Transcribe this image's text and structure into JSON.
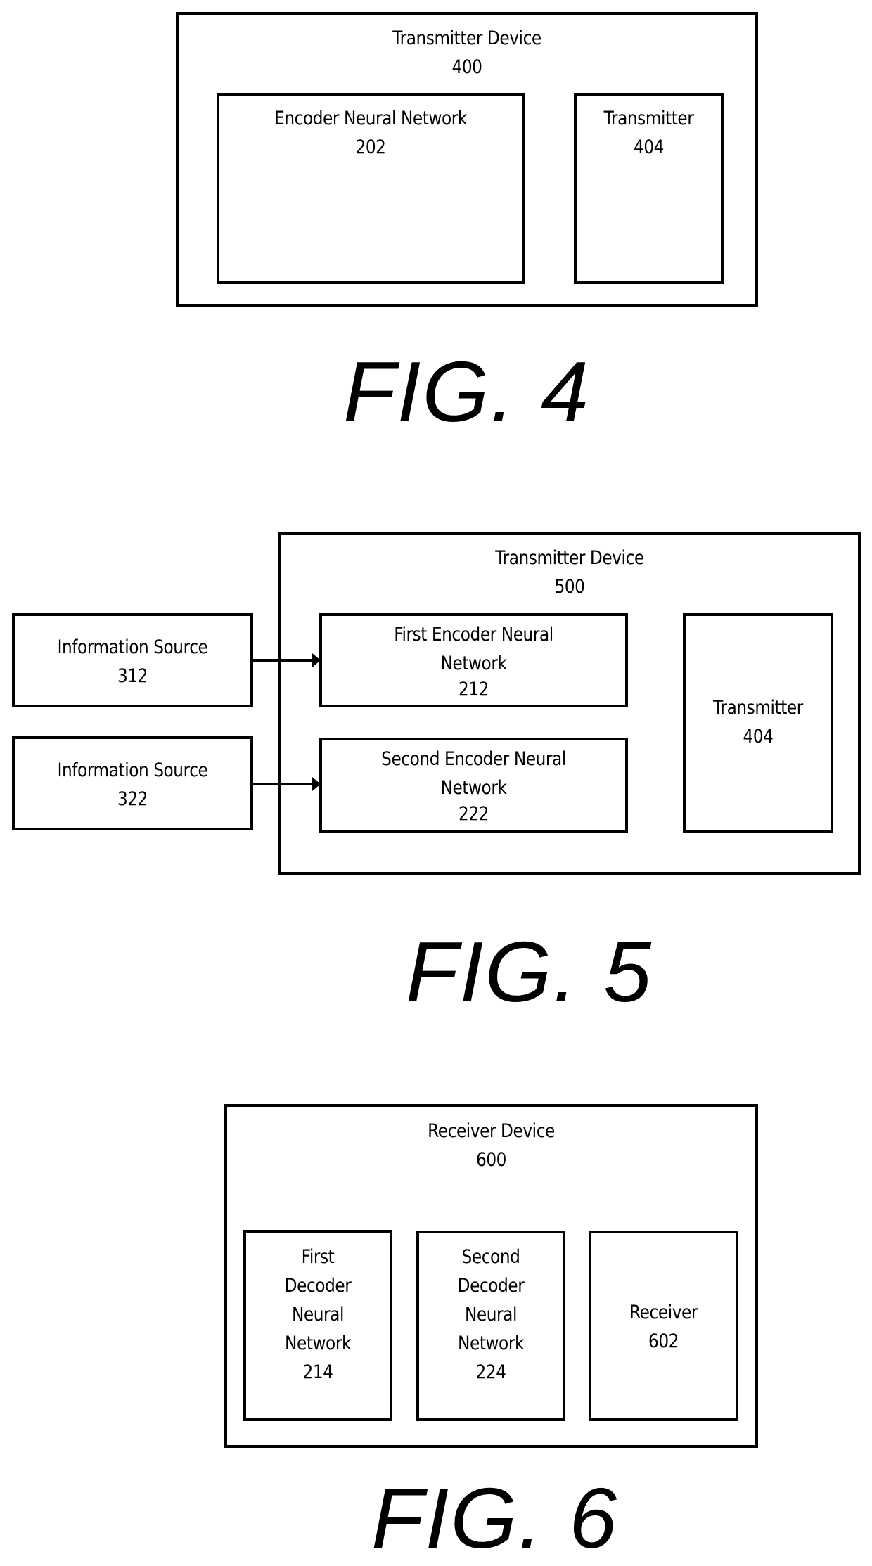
{
  "figures": [
    {
      "caption": "FIG. 4",
      "container": {
        "title": "Transmitter Device",
        "ref": "400"
      },
      "blocks": [
        {
          "title": "Encoder Neural Network",
          "ref": "202"
        },
        {
          "title": "Transmitter",
          "ref": "404"
        }
      ]
    },
    {
      "caption": "FIG. 5",
      "container": {
        "title": "Transmitter Device",
        "ref": "500"
      },
      "sources": [
        {
          "title": "Information Source",
          "ref": "312"
        },
        {
          "title": "Information Source",
          "ref": "322"
        }
      ],
      "blocks": [
        {
          "line1": "First Encoder Neural",
          "line2": "Network",
          "ref": "212"
        },
        {
          "line1": "Second Encoder Neural",
          "line2": "Network",
          "ref": "222"
        },
        {
          "title": "Transmitter",
          "ref": "404"
        }
      ],
      "connections": [
        {
          "from": "Information Source 312",
          "to": "First Encoder Neural Network 212"
        },
        {
          "from": "Information Source 322",
          "to": "Second Encoder Neural Network 222"
        }
      ]
    },
    {
      "caption": "FIG. 6",
      "container": {
        "title": "Receiver Device",
        "ref": "600"
      },
      "blocks": [
        {
          "lines": [
            "First",
            "Decoder",
            "Neural",
            "Network"
          ],
          "ref": "214"
        },
        {
          "lines": [
            "Second",
            "Decoder",
            "Neural",
            "Network"
          ],
          "ref": "224"
        },
        {
          "title": "Receiver",
          "ref": "602"
        }
      ]
    }
  ]
}
